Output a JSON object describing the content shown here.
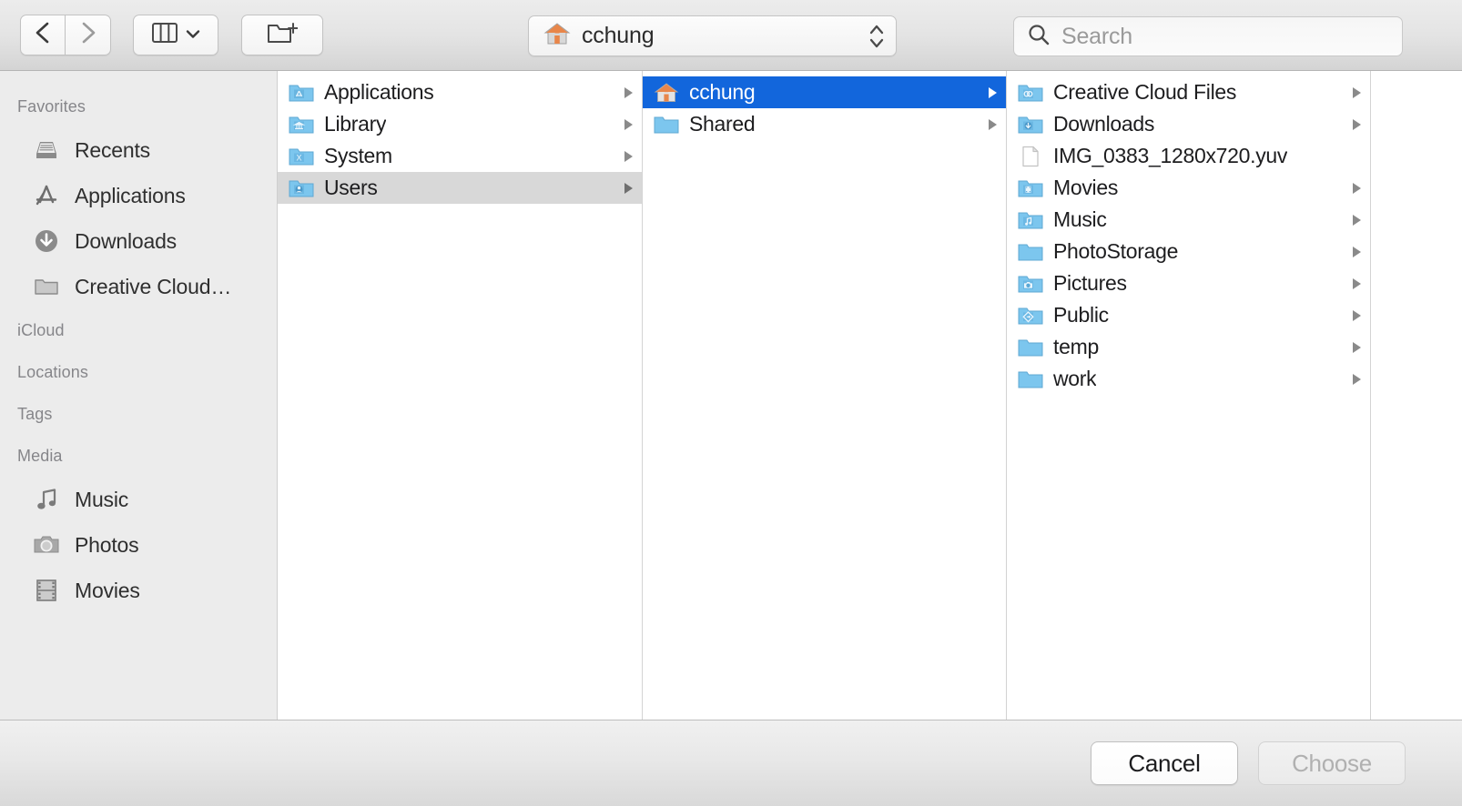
{
  "toolbar": {
    "back_label": "Back",
    "forward_label": "Forward",
    "view_label": "Column View",
    "new_folder_label": "New Folder",
    "path": {
      "label": "cchung",
      "icon": "home-icon"
    },
    "search": {
      "placeholder": "Search",
      "value": "",
      "icon": "search-icon"
    }
  },
  "sidebar": {
    "sections": [
      {
        "title": "Favorites",
        "items": [
          {
            "label": "Recents",
            "icon": "recents-icon"
          },
          {
            "label": "Applications",
            "icon": "applications-icon"
          },
          {
            "label": "Downloads",
            "icon": "downloads-icon"
          },
          {
            "label": "Creative Cloud…",
            "icon": "folder-icon"
          }
        ]
      },
      {
        "title": "iCloud",
        "items": []
      },
      {
        "title": "Locations",
        "items": []
      },
      {
        "title": "Tags",
        "items": []
      },
      {
        "title": "Media",
        "items": [
          {
            "label": "Music",
            "icon": "music-note-icon"
          },
          {
            "label": "Photos",
            "icon": "camera-icon"
          },
          {
            "label": "Movies",
            "icon": "film-icon"
          }
        ]
      }
    ]
  },
  "columns": [
    {
      "name": "column-root",
      "rows": [
        {
          "label": "Applications",
          "icon": "folder-applications-icon",
          "has_arrow": true,
          "selected": "none"
        },
        {
          "label": "Library",
          "icon": "folder-library-icon",
          "has_arrow": true,
          "selected": "none"
        },
        {
          "label": "System",
          "icon": "folder-system-icon",
          "has_arrow": true,
          "selected": "none"
        },
        {
          "label": "Users",
          "icon": "folder-users-icon",
          "has_arrow": true,
          "selected": "inactive"
        }
      ]
    },
    {
      "name": "column-users",
      "rows": [
        {
          "label": "cchung",
          "icon": "home-icon",
          "has_arrow": true,
          "selected": "active"
        },
        {
          "label": "Shared",
          "icon": "folder-icon",
          "has_arrow": true,
          "selected": "none"
        }
      ]
    },
    {
      "name": "column-cchung",
      "rows": [
        {
          "label": "Creative Cloud Files",
          "icon": "folder-creative-cloud-icon",
          "has_arrow": true,
          "selected": "none"
        },
        {
          "label": "Downloads",
          "icon": "folder-downloads-icon",
          "has_arrow": true,
          "selected": "none"
        },
        {
          "label": "IMG_0383_1280x720.yuv",
          "icon": "document-icon",
          "has_arrow": false,
          "selected": "none"
        },
        {
          "label": "Movies",
          "icon": "folder-movies-icon",
          "has_arrow": true,
          "selected": "none"
        },
        {
          "label": "Music",
          "icon": "folder-music-icon",
          "has_arrow": true,
          "selected": "none"
        },
        {
          "label": "PhotoStorage",
          "icon": "folder-icon",
          "has_arrow": true,
          "selected": "none"
        },
        {
          "label": "Pictures",
          "icon": "folder-pictures-icon",
          "has_arrow": true,
          "selected": "none"
        },
        {
          "label": "Public",
          "icon": "folder-public-icon",
          "has_arrow": true,
          "selected": "none"
        },
        {
          "label": "temp",
          "icon": "folder-icon",
          "has_arrow": true,
          "selected": "none"
        },
        {
          "label": "work",
          "icon": "folder-icon",
          "has_arrow": true,
          "selected": "none"
        }
      ]
    }
  ],
  "footer": {
    "cancel_label": "Cancel",
    "choose_label": "Choose",
    "choose_disabled": true
  },
  "colors": {
    "selection_blue": "#1266dc",
    "selection_inactive": "#d8d8d8",
    "folder_blue": "#6cc7f4",
    "sidebar_bg": "#ececec"
  }
}
